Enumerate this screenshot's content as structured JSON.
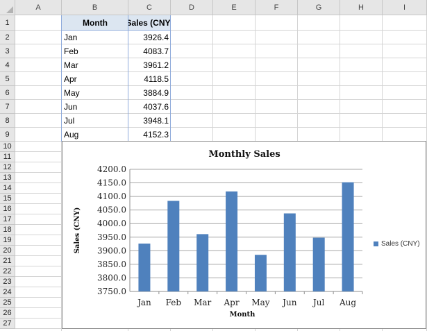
{
  "columns": [
    "A",
    "B",
    "C",
    "D",
    "E",
    "F",
    "G",
    "H",
    "I"
  ],
  "rows": [
    "1",
    "2",
    "3",
    "4",
    "5",
    "6",
    "7",
    "8",
    "9",
    "10",
    "11",
    "12",
    "13",
    "14",
    "15",
    "16",
    "17",
    "18",
    "19",
    "20",
    "21",
    "22",
    "23",
    "24",
    "25",
    "26",
    "27"
  ],
  "table": {
    "header": [
      "Month",
      "Sales (CNY)"
    ],
    "rows": [
      [
        "Jan",
        "3926.4"
      ],
      [
        "Feb",
        "4083.7"
      ],
      [
        "Mar",
        "3961.2"
      ],
      [
        "Apr",
        "4118.5"
      ],
      [
        "May",
        "3884.9"
      ],
      [
        "Jun",
        "4037.6"
      ],
      [
        "Jul",
        "3948.1"
      ],
      [
        "Aug",
        "4152.3"
      ]
    ]
  },
  "chart_data": {
    "type": "bar",
    "title": "Monthly Sales",
    "xlabel": "Month",
    "ylabel": "Sales (CNY)",
    "categories": [
      "Jan",
      "Feb",
      "Mar",
      "Apr",
      "May",
      "Jun",
      "Jul",
      "Aug"
    ],
    "series": [
      {
        "name": "Sales (CNY)",
        "values": [
          3926.4,
          4083.7,
          3961.2,
          4118.5,
          3884.9,
          4037.6,
          3948.1,
          4152.3
        ]
      }
    ],
    "ylim": [
      3750,
      4200
    ],
    "yticks": [
      "4200.0",
      "4150.0",
      "4100.0",
      "4050.0",
      "4000.0",
      "3950.0",
      "3900.0",
      "3850.0",
      "3800.0",
      "3750.0"
    ],
    "grid": true,
    "legend": "right",
    "color": "#4f81bd"
  }
}
